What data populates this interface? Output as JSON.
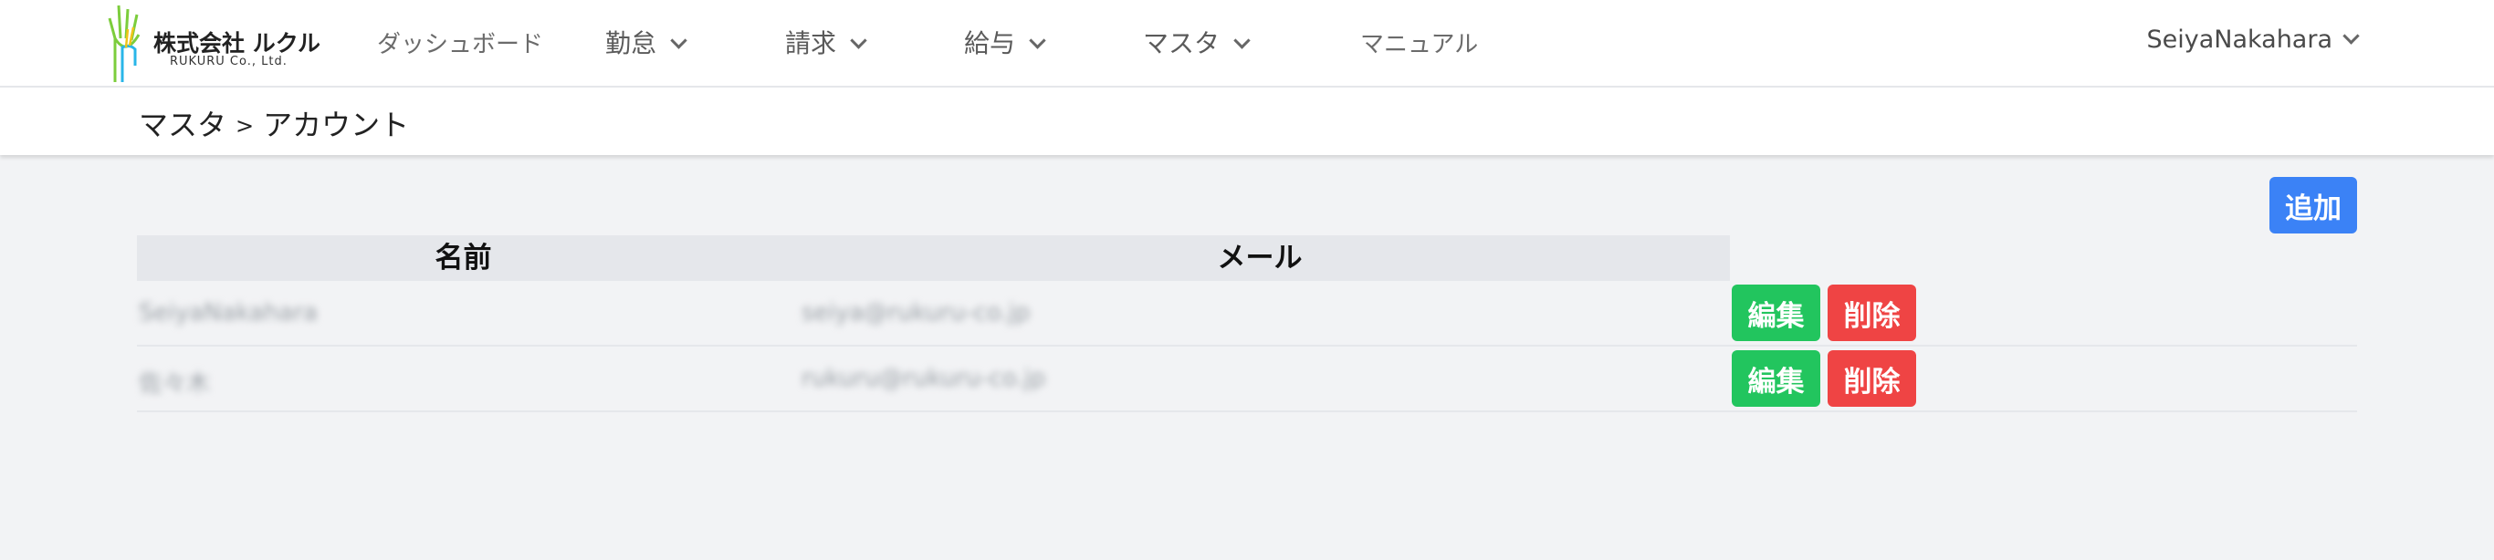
{
  "brand": {
    "name": "株式会社 ルクル",
    "sub": "RUKURU Co., Ltd."
  },
  "nav": {
    "dashboard": "ダッシュボード",
    "attendance": "勤怠",
    "billing": "請求",
    "payroll": "給与",
    "master": "マスタ",
    "manual": "マニュアル",
    "user": "SeiyaNakahara"
  },
  "breadcrumb": {
    "parent": "マスタ",
    "separator": ">",
    "current": "アカウント"
  },
  "actions": {
    "add_label": "追加"
  },
  "table": {
    "headers": [
      "名前",
      "メール"
    ],
    "rows": [
      {
        "name": "SeiyaNakahara",
        "email": "seiya@rukuru-co.jp",
        "edit": "編集",
        "delete": "削除"
      },
      {
        "name": "佐々木",
        "email": "rukuru@rukuru-co.jp",
        "edit": "編集",
        "delete": "削除"
      }
    ]
  },
  "colors": {
    "add": "#3b82f6",
    "edit": "#22c55e",
    "delete": "#ef4444",
    "background": "#f2f3f5"
  }
}
